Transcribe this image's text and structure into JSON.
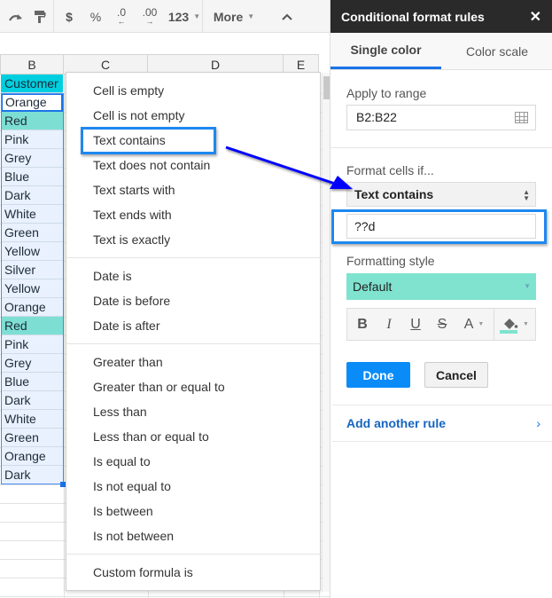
{
  "toolbar": {
    "redo_icon": "redo-icon",
    "paint_format_icon": "paint-format-icon",
    "currency": "$",
    "percent": "%",
    "decrease_decimal": ".0",
    "increase_decimal": ".00",
    "number_format": "123",
    "more_label": "More",
    "collapse_icon": "chevron-up-icon"
  },
  "grid": {
    "columns": [
      "B",
      "C",
      "D",
      "E"
    ],
    "cells": [
      {
        "value": "Customer",
        "style": "header"
      },
      {
        "value": "Orange",
        "style": "active"
      },
      {
        "value": "Red",
        "style": "hl"
      },
      {
        "value": "Pink",
        "style": ""
      },
      {
        "value": "Grey",
        "style": ""
      },
      {
        "value": "Blue",
        "style": ""
      },
      {
        "value": "Dark",
        "style": ""
      },
      {
        "value": "White",
        "style": ""
      },
      {
        "value": "Green",
        "style": ""
      },
      {
        "value": "Yellow",
        "style": ""
      },
      {
        "value": "Silver",
        "style": ""
      },
      {
        "value": "Yellow",
        "style": ""
      },
      {
        "value": "Orange",
        "style": ""
      },
      {
        "value": "Red",
        "style": "hl"
      },
      {
        "value": "Pink",
        "style": ""
      },
      {
        "value": "Grey",
        "style": ""
      },
      {
        "value": "Blue",
        "style": ""
      },
      {
        "value": "Dark",
        "style": ""
      },
      {
        "value": "White",
        "style": ""
      },
      {
        "value": "Green",
        "style": ""
      },
      {
        "value": "Orange",
        "style": ""
      },
      {
        "value": "Dark",
        "style": ""
      }
    ]
  },
  "condition_menu": {
    "groups": [
      [
        "Cell is empty",
        "Cell is not empty",
        "Text contains",
        "Text does not contain",
        "Text starts with",
        "Text ends with",
        "Text is exactly"
      ],
      [
        "Date is",
        "Date is before",
        "Date is after"
      ],
      [
        "Greater than",
        "Greater than or equal to",
        "Less than",
        "Less than or equal to",
        "Is equal to",
        "Is not equal to",
        "Is between",
        "Is not between"
      ],
      [
        "Custom formula is"
      ]
    ],
    "highlighted": "Text contains"
  },
  "panel": {
    "title": "Conditional format rules",
    "tabs": [
      {
        "label": "Single color",
        "active": true
      },
      {
        "label": "Color scale",
        "active": false
      }
    ],
    "apply_range_label": "Apply to range",
    "apply_range_value": "B2:B22",
    "format_if_label": "Format cells if...",
    "condition_value": "Text contains",
    "condition_input": "??d",
    "formatting_style_label": "Formatting style",
    "formatting_style_value": "Default",
    "format_buttons": {
      "bold": "B",
      "italic": "I",
      "underline": "U",
      "strikethrough": "S",
      "text_color": "A"
    },
    "fill_color": "#7fe3cf",
    "done_label": "Done",
    "cancel_label": "Cancel",
    "add_rule_label": "Add another rule"
  },
  "colors": {
    "header_cell": "#00cfe0",
    "highlight_cell": "#7ddfd3",
    "accent_blue": "#1a73e8",
    "callout_blue": "#1e88f0",
    "arrow_blue": "#0000ff"
  }
}
